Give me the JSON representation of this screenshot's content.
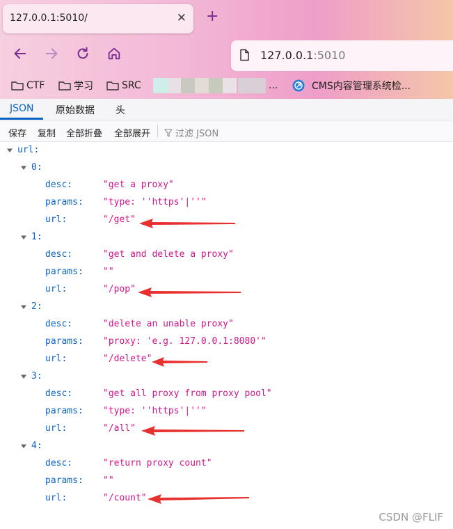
{
  "browser": {
    "tab_title": "127.0.0.1:5010/",
    "address_host": "127.0.0.1",
    "address_port": ":5010",
    "bookmarks": [
      {
        "label": "CTF"
      },
      {
        "label": "学习"
      },
      {
        "label": "SRC"
      }
    ],
    "bookmark_ellipsis": "...",
    "cms_bookmark": "CMS内容管理系统检..."
  },
  "viewer": {
    "tabs": [
      "JSON",
      "原始数据",
      "头"
    ],
    "actions": [
      "保存",
      "复制",
      "全部折叠",
      "全部展开"
    ],
    "filter_placeholder": "过滤 JSON"
  },
  "json": {
    "root_key": "url:",
    "items": [
      {
        "index": "0:",
        "desc": "\"get a proxy\"",
        "params": "\"type: ''https'|''\"",
        "url": "\"/get\""
      },
      {
        "index": "1:",
        "desc": "\"get and delete a proxy\"",
        "params": "\"\"",
        "url": "\"/pop\""
      },
      {
        "index": "2:",
        "desc": "\"delete an unable proxy\"",
        "params": "\"proxy: 'e.g. 127.0.0.1:8080'\"",
        "url": "\"/delete\""
      },
      {
        "index": "3:",
        "desc": "\"get all proxy from proxy pool\"",
        "params": "\"type: ''https'|''\"",
        "url": "\"/all\""
      },
      {
        "index": "4:",
        "desc": "\"return proxy count\"",
        "params": "\"\"",
        "url": "\"/count\""
      }
    ],
    "field_labels": {
      "desc": "desc:",
      "params": "params:",
      "url": "url:"
    }
  },
  "colors": {
    "key": "#0a64c8",
    "string": "#d0168c",
    "arrow": "#e8302e"
  },
  "watermark": "CSDN @FLIF"
}
